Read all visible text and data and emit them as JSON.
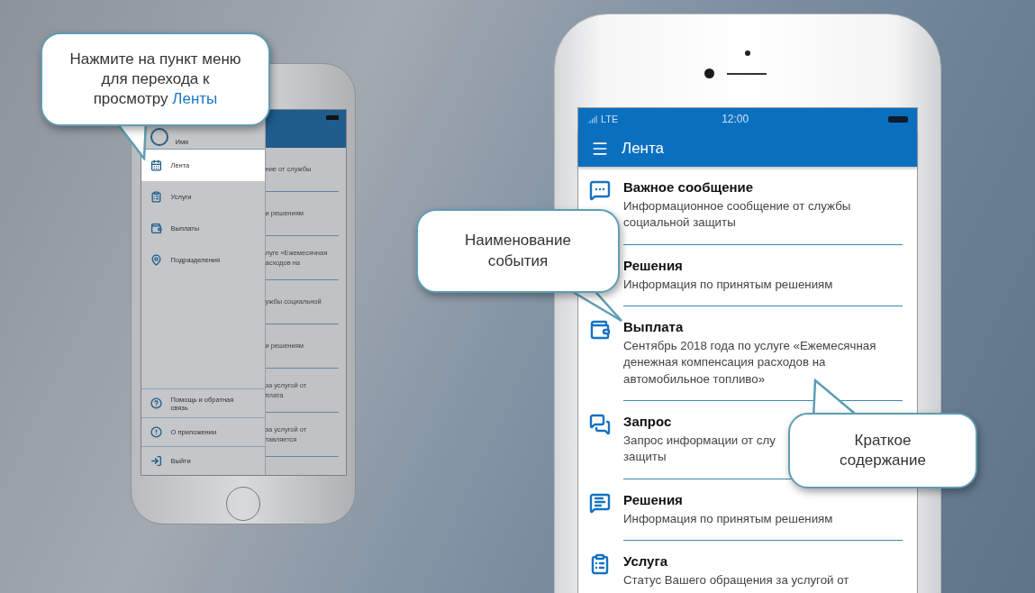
{
  "left_phone": {
    "drawer": {
      "header": "Имя",
      "items": [
        {
          "label": "Лента",
          "kind": "feed",
          "selected": true
        },
        {
          "label": "Услуги",
          "kind": "services",
          "selected": false
        },
        {
          "label": "Выплаты",
          "kind": "payments",
          "selected": false
        },
        {
          "label": "Подразделения",
          "kind": "departments",
          "selected": false
        }
      ],
      "footer_items": [
        {
          "label": "Помощь и обратная связь",
          "kind": "help"
        },
        {
          "label": "О приложении",
          "kind": "about"
        },
        {
          "label": "Выйти",
          "kind": "exit"
        }
      ]
    },
    "feed_fragments": [
      {
        "lines": [
          "ние от службы"
        ]
      },
      {
        "lines": [
          "и решениям"
        ]
      },
      {
        "lines": [
          "луге «Ежемесячная",
          "асходов на"
        ]
      },
      {
        "lines": [
          "ужбы социальной"
        ]
      },
      {
        "lines": [
          "и решениям"
        ]
      },
      {
        "lines": [
          "за услугой от",
          "плата"
        ]
      },
      {
        "lines": [
          "за услугой от",
          "тавляется"
        ]
      }
    ]
  },
  "right_phone": {
    "status_bar": {
      "network": "LTE",
      "time": "12:00"
    },
    "app_bar": {
      "title": "Лента"
    },
    "feed": [
      {
        "kind": "message",
        "title": "Важное сообщение",
        "lines": [
          "Информационное сообщение от службы",
          "социальной защиты"
        ]
      },
      {
        "kind": "decisions",
        "title": "Решения",
        "lines": [
          "Информация по принятым решениям"
        ]
      },
      {
        "kind": "payment",
        "title": "Выплата",
        "lines": [
          "Сентябрь 2018 года по услуге «Ежемесячная",
          "денежная компенсация расходов на",
          "автомобильное топливо»"
        ]
      },
      {
        "kind": "request",
        "title": "Запрос",
        "lines": [
          "Запрос информации от слу",
          "защиты"
        ]
      },
      {
        "kind": "decisions",
        "title": "Решения",
        "lines": [
          "Информация по принятым решениям"
        ]
      },
      {
        "kind": "service",
        "title": "Услуга",
        "lines": [
          "Статус Вашего обращения за услугой от"
        ]
      }
    ]
  },
  "callouts": [
    {
      "kind": "menu_hint",
      "text": "Нажмите на пункт меню для перехода к просмотру",
      "highlight": "Ленты"
    },
    {
      "kind": "event_name",
      "text": "Наименование события"
    },
    {
      "kind": "summary",
      "text": "Краткое содержание"
    }
  ]
}
